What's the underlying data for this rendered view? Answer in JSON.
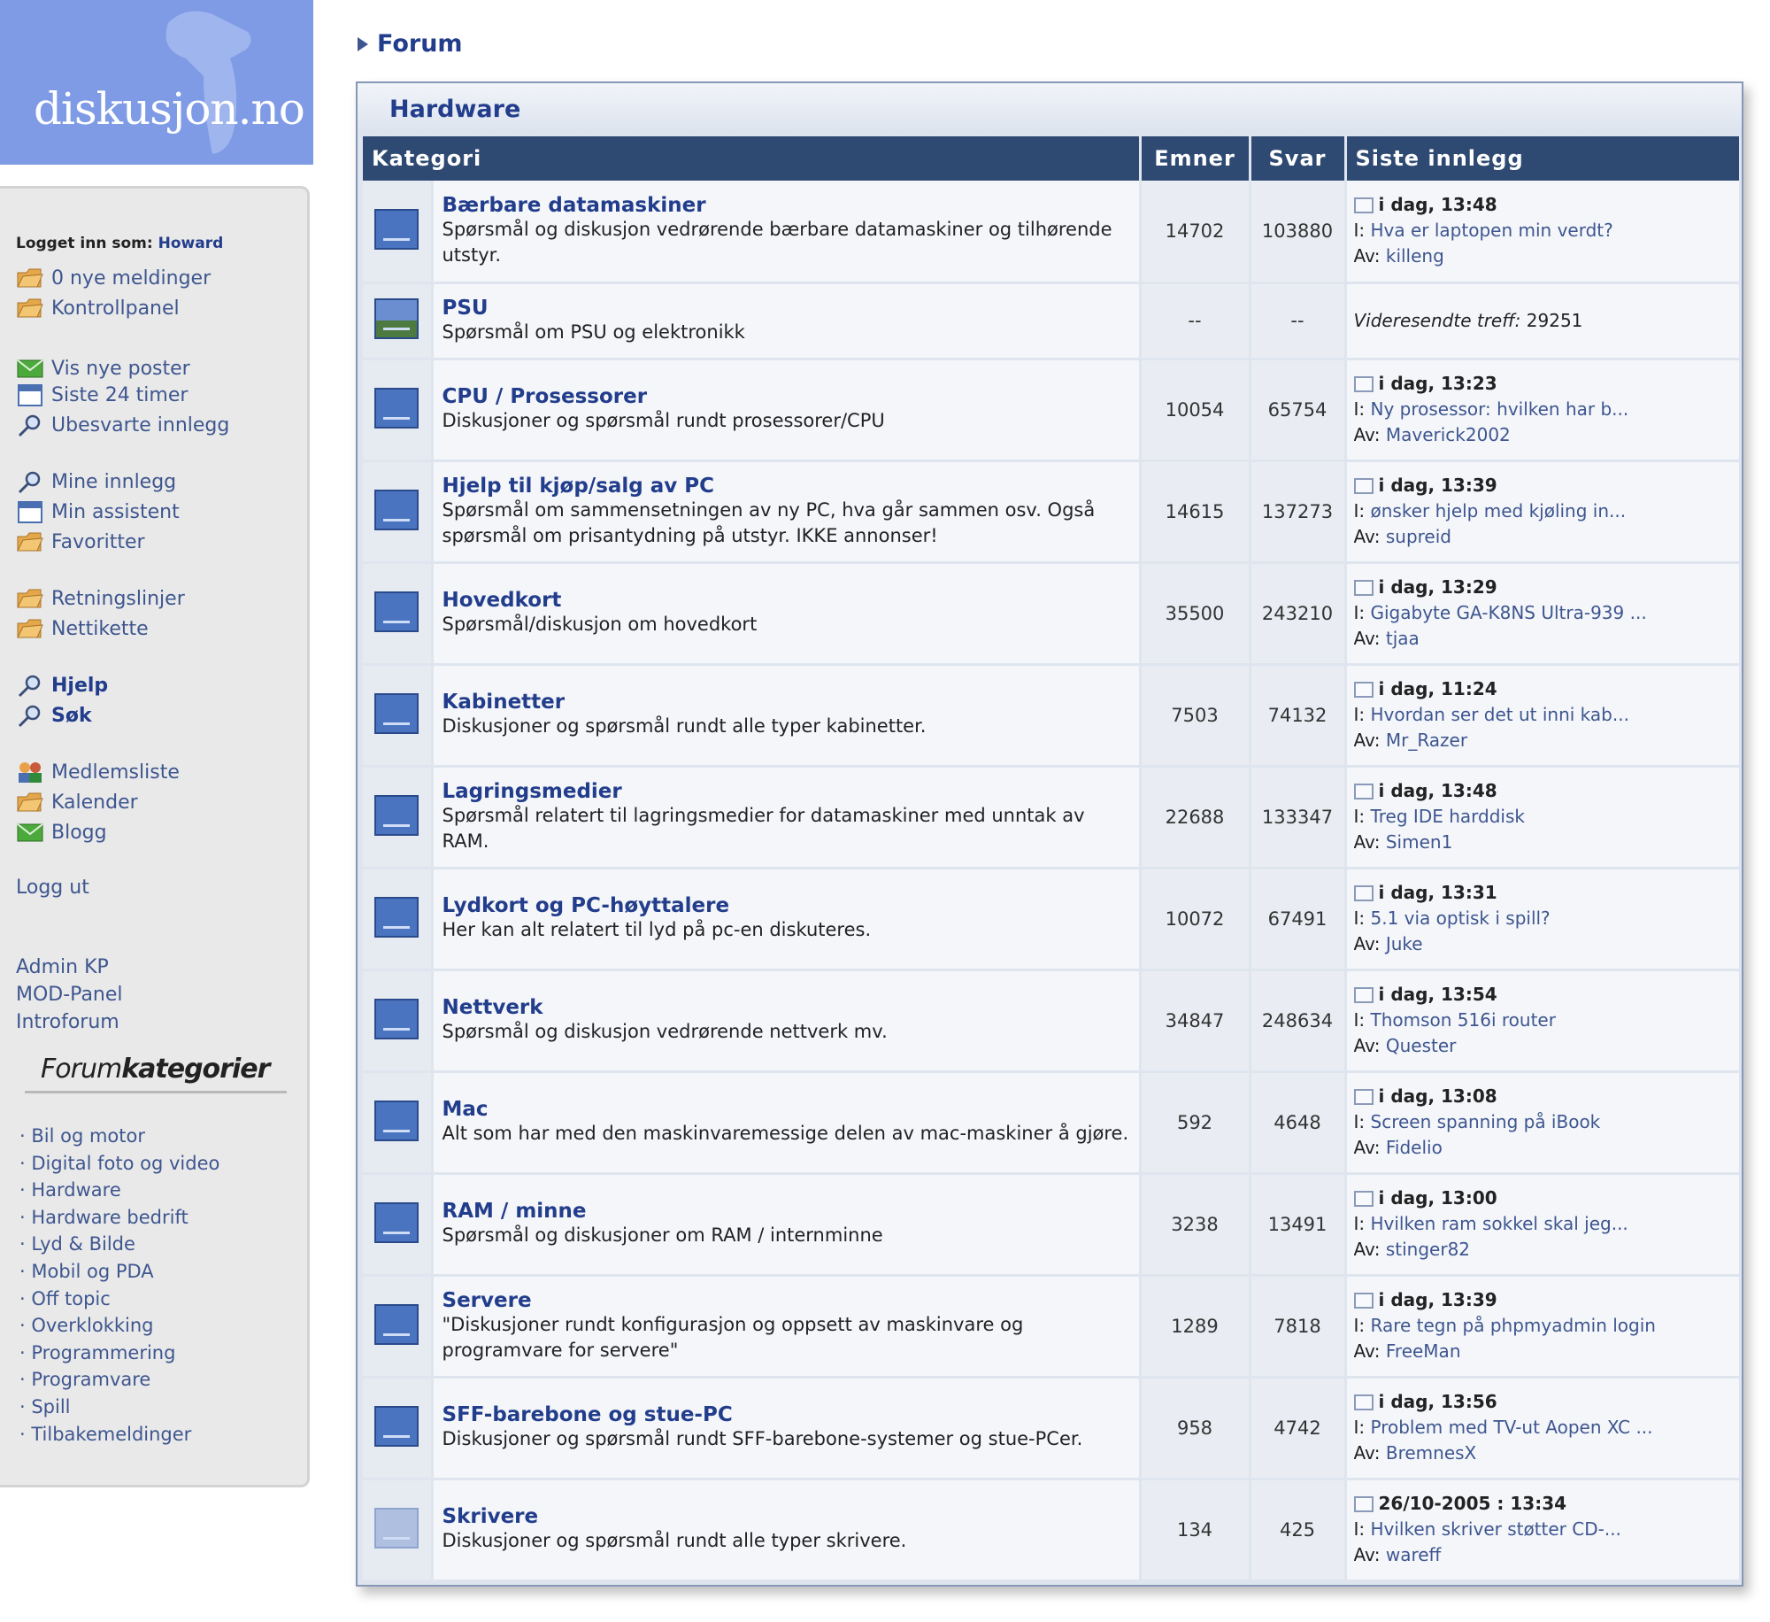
{
  "site": {
    "logo_text": "diskusjon.no"
  },
  "sidebar": {
    "login_label": "Logget inn som:",
    "username": "Howard",
    "links": [
      {
        "label": "0 nye meldinger",
        "icon": "folder-icon"
      },
      {
        "label": "Kontrollpanel",
        "icon": "folder-icon"
      },
      {
        "label": "Vis nye poster",
        "icon": "envelope-icon"
      },
      {
        "label": "Siste 24 timer",
        "icon": "calendar-icon"
      },
      {
        "label": "Ubesvarte innlegg",
        "icon": "search-icon"
      },
      {
        "label": "Mine innlegg",
        "icon": "search-icon"
      },
      {
        "label": "Min assistent",
        "icon": "calendar-icon"
      },
      {
        "label": "Favoritter",
        "icon": "folder-icon"
      },
      {
        "label": "Retningslinjer",
        "icon": "folder-icon"
      },
      {
        "label": "Nettikette",
        "icon": "folder-icon"
      },
      {
        "label": "Hjelp",
        "icon": "search-icon"
      },
      {
        "label": "Søk",
        "icon": "search-icon"
      },
      {
        "label": "Medlemsliste",
        "icon": "members-icon"
      },
      {
        "label": "Kalender",
        "icon": "folder-icon"
      },
      {
        "label": "Blogg",
        "icon": "envelope-icon"
      }
    ],
    "logout": "Logg ut",
    "admin_links": [
      "Admin KP",
      "MOD-Panel",
      "Introforum"
    ],
    "forumkategorier_a": "Forum",
    "forumkategorier_b": "kategorier",
    "categories": [
      "· Bil og motor",
      "· Digital foto og video",
      "· Hardware",
      "· Hardware bedrift",
      "· Lyd & Bilde",
      "· Mobil og PDA",
      "· Off topic",
      "· Overklokking",
      "· Programmering",
      "· Programvare",
      "· Spill",
      "· Tilbakemeldinger"
    ]
  },
  "breadcrumb": "Forum",
  "section": {
    "title": "Hardware",
    "columns": {
      "category": "Kategori",
      "topics": "Emner",
      "replies": "Svar",
      "last": "Siste innlegg"
    },
    "topic_prefix": "I:",
    "author_prefix": "Av:",
    "forums": [
      {
        "name": "Bærbare datamaskiner",
        "desc": "Spørsmål og diskusjon vedrørende bærbare datamaskiner og tilhørende utstyr.",
        "topics": "14702",
        "replies": "103880",
        "date": "i dag, 13:48",
        "topic": "Hva er laptopen min verdt?",
        "author": "killeng"
      },
      {
        "name": "PSU",
        "desc": "Spørsmål om PSU og elektronikk",
        "topics": "--",
        "replies": "--",
        "redirect_label": "Videresendte treff:",
        "redirect_value": "29251"
      },
      {
        "name": "CPU / Prosessorer",
        "desc": "Diskusjoner og spørsmål rundt prosessorer/CPU",
        "topics": "10054",
        "replies": "65754",
        "date": "i dag, 13:23",
        "topic": "Ny prosessor: hvilken har b...",
        "author": "Maverick2002"
      },
      {
        "name": "Hjelp til kjøp/salg av PC",
        "desc": "Spørsmål om sammensetningen av ny PC, hva går sammen osv. Også spørsmål om prisantydning på utstyr. IKKE annonser!",
        "topics": "14615",
        "replies": "137273",
        "date": "i dag, 13:39",
        "topic": "ønsker hjelp med kjøling in...",
        "author": "supreid"
      },
      {
        "name": "Hovedkort",
        "desc": "Spørsmål/diskusjon om hovedkort",
        "topics": "35500",
        "replies": "243210",
        "date": "i dag, 13:29",
        "topic": "Gigabyte GA-K8NS Ultra-939 ...",
        "author": "tjaa"
      },
      {
        "name": "Kabinetter",
        "desc": "Diskusjoner og spørsmål rundt alle typer kabinetter.",
        "topics": "7503",
        "replies": "74132",
        "date": "i dag, 11:24",
        "topic": "Hvordan ser det ut inni kab...",
        "author": "Mr_Razer"
      },
      {
        "name": "Lagringsmedier",
        "desc": "Spørsmål relatert til lagringsmedier for datamaskiner med unntak av RAM.",
        "topics": "22688",
        "replies": "133347",
        "date": "i dag, 13:48",
        "topic": "Treg IDE harddisk",
        "author": "Simen1"
      },
      {
        "name": "Lydkort og PC-høyttalere",
        "desc": "Her kan alt relatert til lyd på pc-en diskuteres.",
        "topics": "10072",
        "replies": "67491",
        "date": "i dag, 13:31",
        "topic": "5.1 via optisk i spill?",
        "author": "Juke"
      },
      {
        "name": "Nettverk",
        "desc": "Spørsmål og diskusjon vedrørende nettverk mv.",
        "topics": "34847",
        "replies": "248634",
        "date": "i dag, 13:54",
        "topic": "Thomson 516i router",
        "author": "Quester"
      },
      {
        "name": "Mac",
        "desc": "Alt som har med den maskinvaremessige delen av mac-maskiner å gjøre.",
        "topics": "592",
        "replies": "4648",
        "date": "i dag, 13:08",
        "topic": "Screen spanning på iBook",
        "author": "Fidelio"
      },
      {
        "name": "RAM / minne",
        "desc": "Spørsmål og diskusjoner om RAM / internminne",
        "topics": "3238",
        "replies": "13491",
        "date": "i dag, 13:00",
        "topic": "Hvilken ram sokkel skal jeg...",
        "author": "stinger82"
      },
      {
        "name": "Servere",
        "desc": "\"Diskusjoner rundt konfigurasjon og oppsett av maskinvare og programvare for servere\"",
        "topics": "1289",
        "replies": "7818",
        "date": "i dag, 13:39",
        "topic": "Rare tegn på phpmyadmin login",
        "author": "FreeMan"
      },
      {
        "name": "SFF-barebone og stue-PC",
        "desc": "Diskusjoner og spørsmål rundt SFF-barebone-systemer og stue-PCer.",
        "topics": "958",
        "replies": "4742",
        "date": "i dag, 13:56",
        "topic": "Problem med TV-ut Aopen XC ...",
        "author": "BremnesX"
      },
      {
        "name": "Skrivere",
        "desc": "Diskusjoner og spørsmål rundt alle typer skrivere.",
        "topics": "134",
        "replies": "425",
        "date": "26/10-2005 : 13:34",
        "topic": "Hvilken skriver støtter CD-...",
        "author": "wareff"
      }
    ]
  },
  "colors": {
    "header_bg": "#2e4a72",
    "link": "#3e568f",
    "logo_bg": "#7f9be6"
  }
}
